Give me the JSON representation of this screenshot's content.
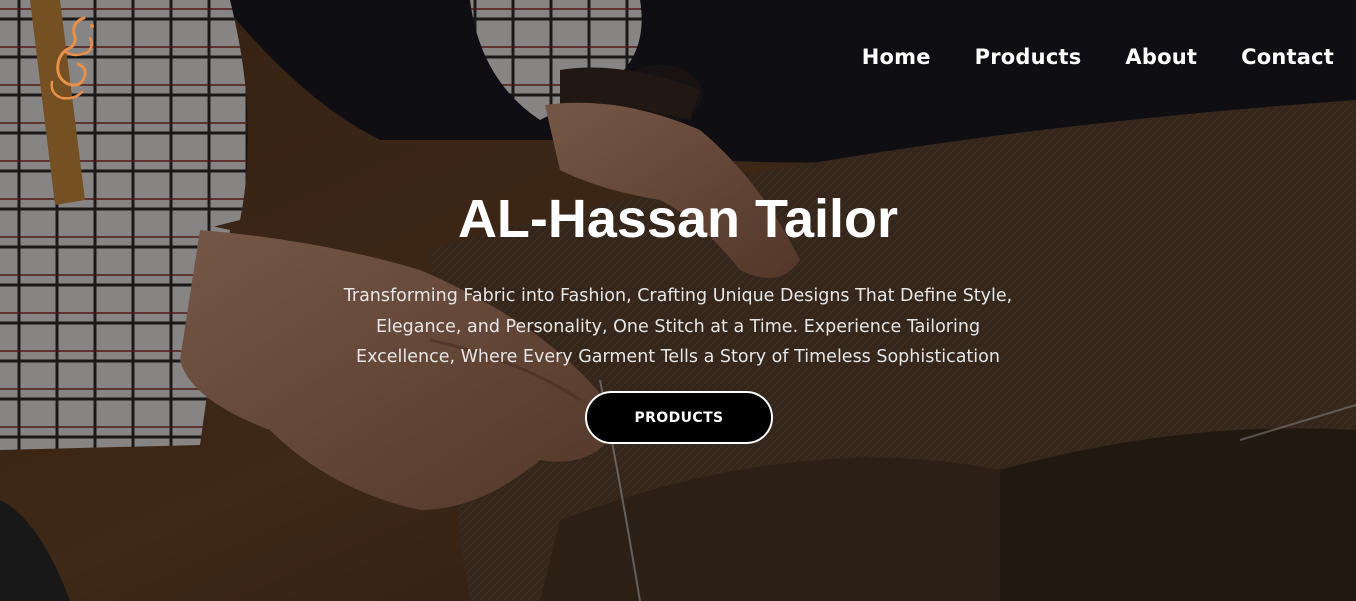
{
  "nav": {
    "items": [
      {
        "label": "Home"
      },
      {
        "label": "Products"
      },
      {
        "label": "About"
      },
      {
        "label": "Contact"
      }
    ]
  },
  "hero": {
    "title": "AL-Hassan Tailor",
    "subtitle": "Transforming Fabric into Fashion, Crafting Unique Designs That Define Style, Elegance, and Personality, One Stitch at a Time. Experience Tailoring Excellence, Where Every Garment Tells a Story of Timeless Sophistication",
    "cta_label": "PRODUCTS"
  },
  "colors": {
    "logo_accent": "#e8904a",
    "text": "#ffffff",
    "button_bg": "#000000",
    "button_border": "#ffffff"
  }
}
